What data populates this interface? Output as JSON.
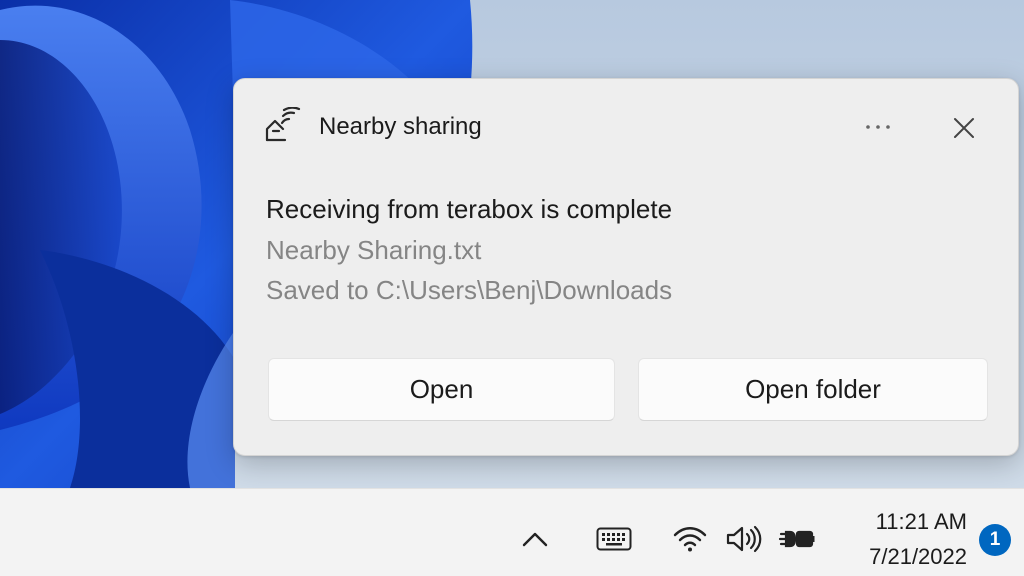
{
  "notification": {
    "app_name": "Nearby sharing",
    "app_icon": "nearby-sharing-icon",
    "title": "Receiving from terabox is complete",
    "line1": "Nearby Sharing.txt",
    "line2": "Saved to C:\\Users\\Benj\\Downloads",
    "more_icon": "more-options-icon",
    "close_icon": "close-icon",
    "buttons": [
      {
        "label": "Open"
      },
      {
        "label": "Open folder"
      }
    ]
  },
  "taskbar": {
    "tray_icons": [
      "chevron-up-icon",
      "keyboard-icon",
      "wifi-icon",
      "volume-icon",
      "battery-charging-icon"
    ],
    "time": "11:21 AM",
    "date": "7/21/2022",
    "notification_count": "1"
  },
  "colors": {
    "accent": "#0067c0",
    "wallpaper_blue": "#1a4fd1",
    "toast_bg": "#eeeeee",
    "taskbar_bg": "#f3f3f3"
  }
}
